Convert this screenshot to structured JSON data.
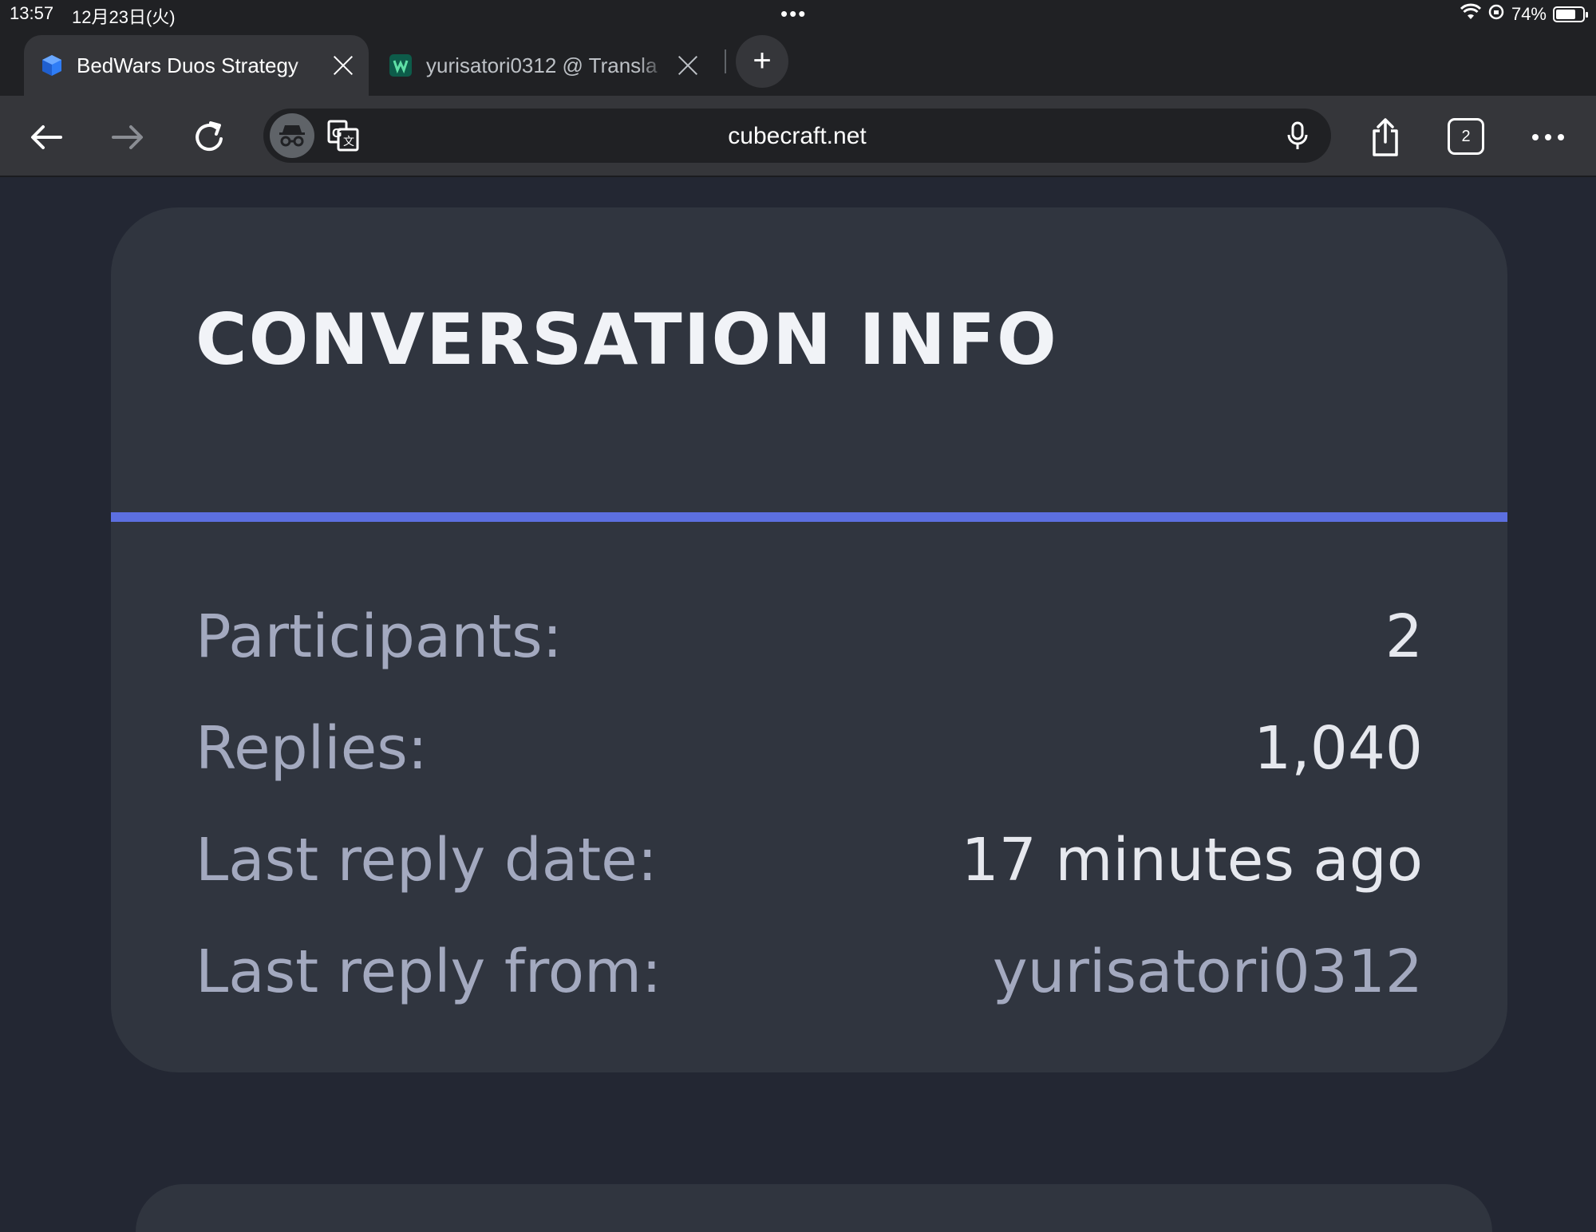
{
  "status_bar": {
    "time": "13:57",
    "date": "12月23日(火)",
    "battery": "74%",
    "battery_level": 0.74
  },
  "tabs": [
    {
      "label": "BedWars Duos Strategy",
      "icon": "cube-icon",
      "active": true
    },
    {
      "label": "yurisatori0312 @ Transla",
      "icon": "translate-site-icon",
      "active": false
    }
  ],
  "toolbar": {
    "url": "cubecraft.net",
    "tab_count": "2"
  },
  "card": {
    "title": "CONVERSATION INFO",
    "rows": [
      {
        "label": "Participants:",
        "value": "2"
      },
      {
        "label": "Replies:",
        "value": "1,040"
      },
      {
        "label": "Last reply date:",
        "value": "17 minutes ago"
      },
      {
        "label": "Last reply from:",
        "value": "yurisatori0312"
      }
    ]
  },
  "colors": {
    "accent": "#5c6fe0",
    "card_background": "#30353f",
    "page_background": "#232733"
  }
}
